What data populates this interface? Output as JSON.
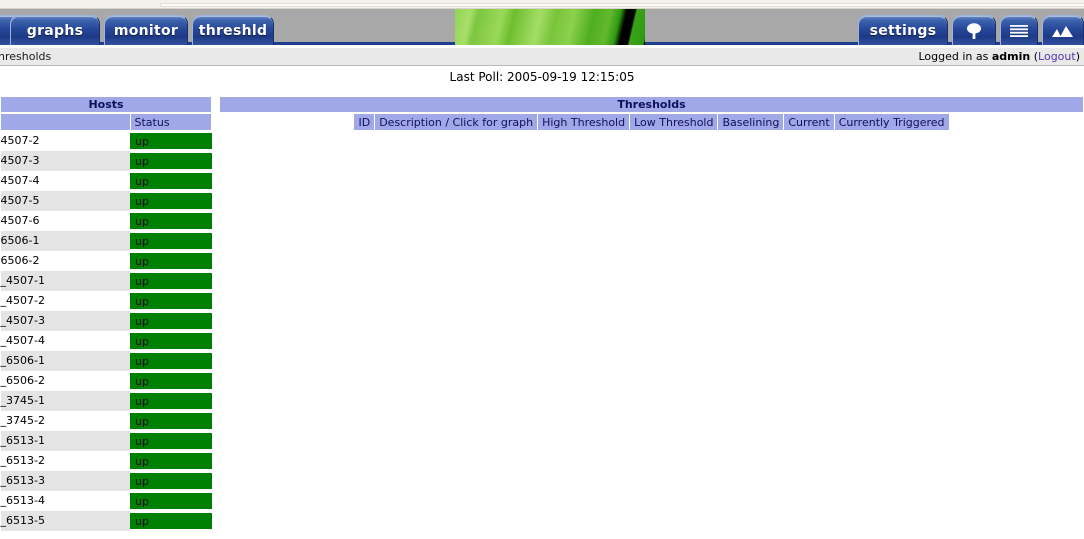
{
  "window": {
    "title": "Thresholds"
  },
  "nav": {
    "tabs": [
      {
        "id": "partial",
        "label": "",
        "icon": "",
        "active": false
      },
      {
        "id": "graphs",
        "label": "graphs",
        "icon": "",
        "active": false
      },
      {
        "id": "monitor",
        "label": "monitor",
        "icon": "",
        "active": false
      },
      {
        "id": "threshld",
        "label": "threshld",
        "icon": "",
        "active": true
      },
      {
        "id": "settings",
        "label": "settings",
        "icon": "",
        "active": false
      },
      {
        "id": "tree",
        "label": "",
        "icon": "tree-icon",
        "active": false
      },
      {
        "id": "list",
        "label": "",
        "icon": "list-icon",
        "active": false
      },
      {
        "id": "mountain",
        "label": "",
        "icon": "mountain-icon",
        "active": false
      }
    ]
  },
  "crumbbar": {
    "breadcrumb": "hresholds",
    "logged_in_prefix": "Logged in as",
    "username": "admin",
    "paren_open": "(",
    "logout_label": "Logout",
    "paren_close": ")"
  },
  "status": {
    "last_poll": "Last Poll: 2005-09-19 12:15:05"
  },
  "hosts_panel": {
    "title": "Hosts",
    "columns": [
      "",
      "Status"
    ],
    "rows": [
      {
        "name": "4507-2",
        "status": "up"
      },
      {
        "name": "4507-3",
        "status": "up"
      },
      {
        "name": "4507-4",
        "status": "up"
      },
      {
        "name": "4507-5",
        "status": "up"
      },
      {
        "name": "4507-6",
        "status": "up"
      },
      {
        "name": "6506-1",
        "status": "up"
      },
      {
        "name": "6506-2",
        "status": "up"
      },
      {
        "name": "_4507-1",
        "status": "up"
      },
      {
        "name": "_4507-2",
        "status": "up"
      },
      {
        "name": "_4507-3",
        "status": "up"
      },
      {
        "name": "_4507-4",
        "status": "up"
      },
      {
        "name": "_6506-1",
        "status": "up"
      },
      {
        "name": "_6506-2",
        "status": "up"
      },
      {
        "name": "_3745-1",
        "status": "up"
      },
      {
        "name": "_3745-2",
        "status": "up"
      },
      {
        "name": "_6513-1",
        "status": "up"
      },
      {
        "name": "_6513-2",
        "status": "up"
      },
      {
        "name": "_6513-3",
        "status": "up"
      },
      {
        "name": "_6513-4",
        "status": "up"
      },
      {
        "name": "_6513-5",
        "status": "up"
      }
    ]
  },
  "thresholds_panel": {
    "title": "Thresholds",
    "columns": [
      "ID",
      "Description / Click for graph",
      "High Threshold",
      "Low Threshold",
      "Baselining",
      "Current",
      "Currently Triggered"
    ],
    "rows": []
  },
  "colors": {
    "header_lavender": "#a0a8e8",
    "header_text": "#10105a",
    "status_up_green": "#008000",
    "tab_blue": "#27479a",
    "tabbar_gray": "#a8a8a8",
    "row_alt_gray": "#e4e4e4",
    "logout_link": "#5533aa"
  }
}
